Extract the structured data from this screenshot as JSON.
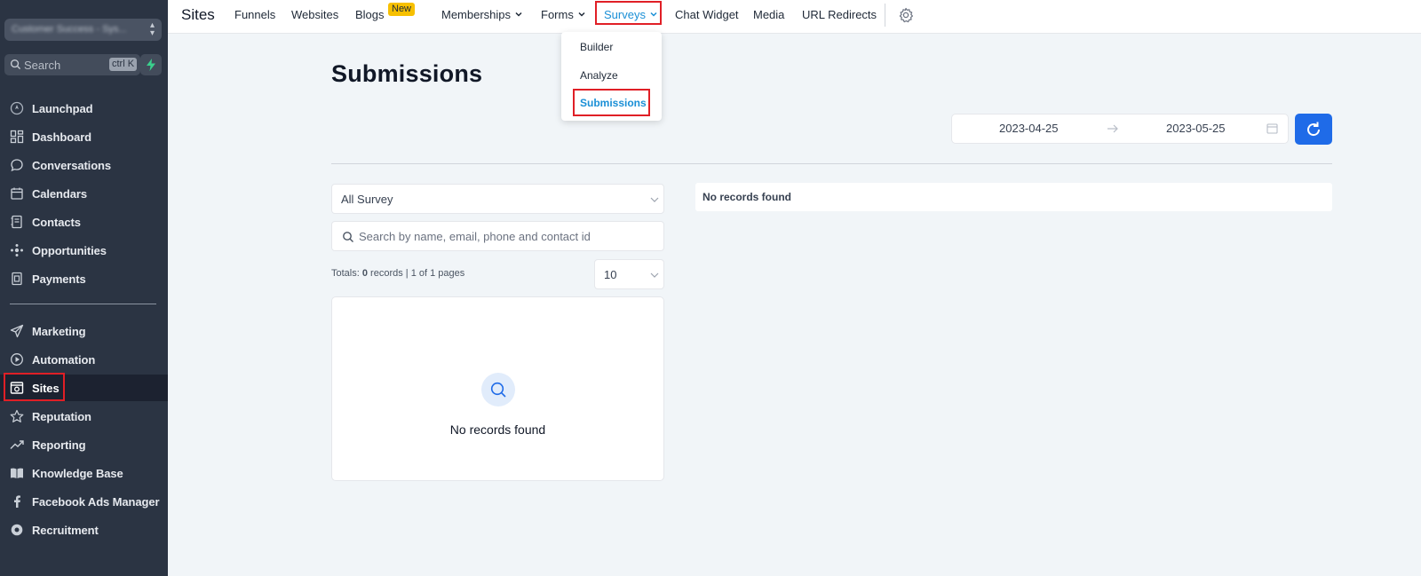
{
  "sidebar": {
    "account_name": "Customer Success - Sys...",
    "search_placeholder": "Search",
    "search_shortcut": "ctrl K",
    "items": [
      {
        "label": "Launchpad",
        "icon": "rocket-icon"
      },
      {
        "label": "Dashboard",
        "icon": "dashboard-icon"
      },
      {
        "label": "Conversations",
        "icon": "chat-icon"
      },
      {
        "label": "Calendars",
        "icon": "calendar-icon"
      },
      {
        "label": "Contacts",
        "icon": "contacts-icon"
      },
      {
        "label": "Opportunities",
        "icon": "opportunities-icon"
      },
      {
        "label": "Payments",
        "icon": "payments-icon"
      }
    ],
    "items2": [
      {
        "label": "Marketing",
        "icon": "send-icon"
      },
      {
        "label": "Automation",
        "icon": "automation-icon"
      },
      {
        "label": "Sites",
        "icon": "sites-icon",
        "active": true
      },
      {
        "label": "Reputation",
        "icon": "star-icon"
      },
      {
        "label": "Reporting",
        "icon": "trending-icon"
      },
      {
        "label": "Knowledge Base",
        "icon": "book-icon"
      },
      {
        "label": "Facebook Ads Manager",
        "icon": "facebook-icon"
      },
      {
        "label": "Recruitment",
        "icon": "recruitment-icon"
      }
    ]
  },
  "topnav": {
    "title": "Sites",
    "links": {
      "funnels": "Funnels",
      "websites": "Websites",
      "blogs": "Blogs",
      "blogs_badge": "New",
      "memberships": "Memberships",
      "forms": "Forms",
      "surveys": "Surveys",
      "chat_widget": "Chat Widget",
      "media": "Media",
      "url_redirects": "URL Redirects"
    },
    "surveys_menu": [
      "Builder",
      "Analyze",
      "Submissions"
    ]
  },
  "main": {
    "title": "Submissions",
    "date_start": "2023-04-25",
    "date_end": "2023-05-25",
    "survey_filter": "All Survey",
    "search_placeholder": "Search by name, email, phone and contact id",
    "totals_prefix": "Totals: ",
    "totals_count": "0",
    "totals_suffix": " records | 1 of 1 pages",
    "page_size": "10",
    "empty_text": "No records found",
    "results_empty_text": "No records found"
  },
  "colors": {
    "sidebar_bg": "#2b3443",
    "accent": "#1a8fd6",
    "primary_button": "#1f6be8",
    "highlight": "#e01f26",
    "badge": "#f7c000"
  }
}
